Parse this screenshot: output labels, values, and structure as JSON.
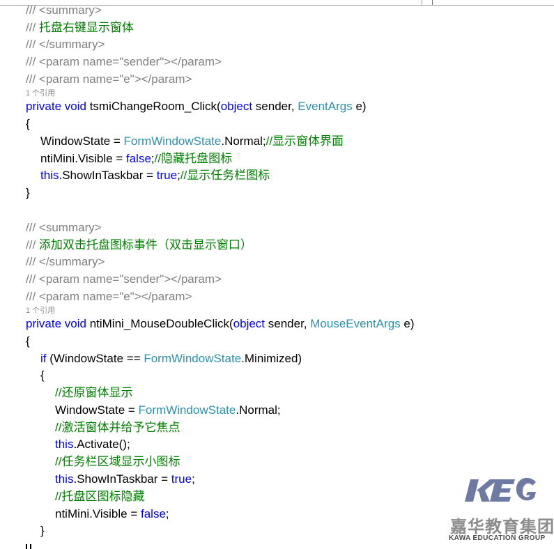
{
  "watermark": {
    "logo": "KEG",
    "name_cn": "嘉华教育集团",
    "name_en": "KAWA EDUCATION GROUP"
  },
  "code": {
    "method1": {
      "doc": [
        {
          "pre": "/// ",
          "tag": "<summary>"
        },
        {
          "pre": "/// ",
          "text": "托盘右键显示窗体"
        },
        {
          "pre": "/// ",
          "tag": "</summary>"
        },
        {
          "pre": "/// ",
          "tag": "<param name=\"sender\"></param>"
        },
        {
          "pre": "/// ",
          "tag": "<param name=\"e\"></param>"
        }
      ],
      "refs": "1 个引用",
      "sig": {
        "kw1": "private",
        "kw2": "void",
        "name": "tsmiChangeRoom_Click(",
        "kw3": "object",
        "p1": " sender, ",
        "ty": "EventArgs",
        "p2": " e)"
      },
      "open": "{",
      "l1": {
        "a": "WindowState = ",
        "ty": "FormWindowState",
        "b": ".Normal;",
        "cm": "//显示窗体界面"
      },
      "l2": {
        "a": "ntiMini.Visible = ",
        "kw": "false",
        "b": ";",
        "cm": "//隐藏托盘图标"
      },
      "l3": {
        "kw": "this",
        "a": ".ShowInTaskbar = ",
        "kw2": "true",
        "b": ";",
        "cm": "//显示任务栏图标"
      },
      "close": "}"
    },
    "method2": {
      "doc": [
        {
          "pre": "/// ",
          "tag": "<summary>"
        },
        {
          "pre": "/// ",
          "text": "添加双击托盘图标事件（双击显示窗口）"
        },
        {
          "pre": "/// ",
          "tag": "</summary>"
        },
        {
          "pre": "/// ",
          "tag": "<param name=\"sender\"></param>"
        },
        {
          "pre": "/// ",
          "tag": "<param name=\"e\"></param>"
        }
      ],
      "refs": "1 个引用",
      "sig": {
        "kw1": "private",
        "kw2": "void",
        "name": "ntiMini_MouseDoubleClick(",
        "kw3": "object",
        "p1": " sender, ",
        "ty": "MouseEventArgs",
        "p2": " e)"
      },
      "open": "{",
      "if": {
        "kw": "if",
        "a": " (WindowState == ",
        "ty": "FormWindowState",
        "b": ".Minimized)"
      },
      "open2": "{",
      "c1": "//还原窗体显示",
      "s1": {
        "a": "WindowState = ",
        "ty": "FormWindowState",
        "b": ".Normal;"
      },
      "c2": "//激活窗体并给予它焦点",
      "s2": {
        "kw": "this",
        "a": ".Activate();"
      },
      "c3": "//任务栏区域显示小图标",
      "s3": {
        "kw": "this",
        "a": ".ShowInTaskbar = ",
        "kw2": "true",
        "b": ";"
      },
      "c4": "//托盘区图标隐藏",
      "s4": {
        "a": "ntiMini.Visible = ",
        "kw": "false",
        "b": ";"
      },
      "close2": "}"
    }
  }
}
